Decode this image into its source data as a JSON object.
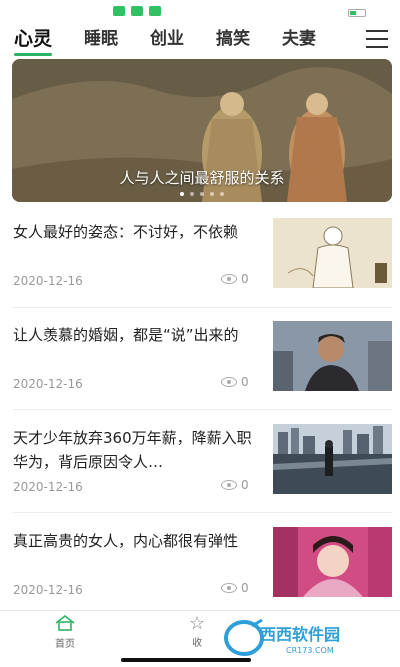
{
  "tabs": [
    {
      "label": "心灵",
      "active": true
    },
    {
      "label": "睡眠"
    },
    {
      "label": "创业"
    },
    {
      "label": "搞笑"
    },
    {
      "label": "夫妻"
    }
  ],
  "banner": {
    "caption": "人与人之间最舒服的关系",
    "dot_count": 5,
    "active_dot": 0
  },
  "articles": [
    {
      "title": "女人最好的姿态：不讨好，不依赖",
      "date": "2020-12-16",
      "views": "0",
      "thumb": "illustration-man"
    },
    {
      "title": "让人羡慕的婚姻，都是“说”出来的",
      "date": "2020-12-16",
      "views": "0",
      "thumb": "man-portrait"
    },
    {
      "title": "天才少年放弃360万年薪，降薪入职华为，背后原因令人…",
      "date": "2020-12-16",
      "views": "0",
      "thumb": "city-river"
    },
    {
      "title": "真正高贵的女人，内心都很有弹性",
      "date": "2020-12-16",
      "views": "0",
      "thumb": "woman-costume"
    }
  ],
  "bottom_nav": [
    {
      "label": "首页",
      "icon": "home-icon",
      "active": true
    },
    {
      "label": "收",
      "icon": "star-icon"
    }
  ],
  "watermark": {
    "text": "西西软件园",
    "sub": "CR173.COM"
  },
  "colors": {
    "accent": "#2db364",
    "text": "#222222",
    "muted": "#999999"
  }
}
